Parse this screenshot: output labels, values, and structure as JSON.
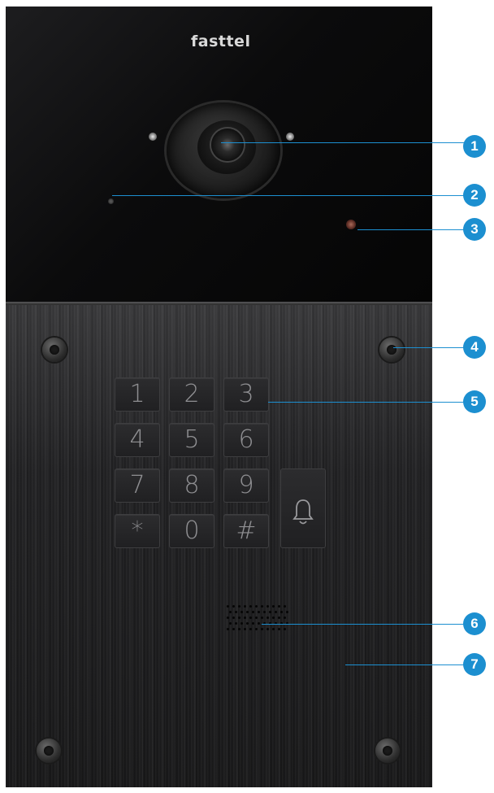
{
  "brand": "fasttel",
  "keypad": {
    "keys": [
      "1",
      "2",
      "3",
      "4",
      "5",
      "6",
      "7",
      "8",
      "9",
      "*",
      "0",
      "#"
    ]
  },
  "bell_icon": "bell-icon",
  "callouts": [
    "1",
    "2",
    "3",
    "4",
    "5",
    "6",
    "7"
  ],
  "colors": {
    "callout": "#1c8fd0",
    "glass": "#0b0b0c",
    "metal": "#222224"
  }
}
